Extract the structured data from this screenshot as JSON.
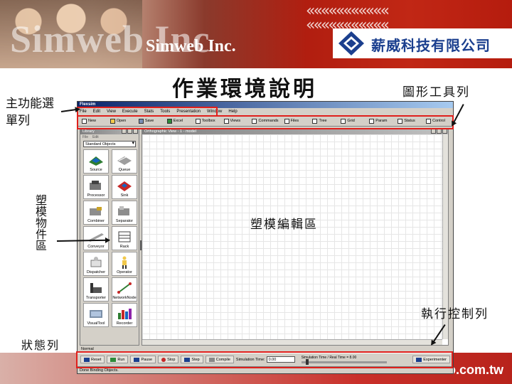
{
  "slide": {
    "brand_big": "Simweb Inc",
    "brand_small": "Simweb Inc.",
    "company_name": "薪威科技有限公司",
    "title": "作業環境說明",
    "footer_url": "o.com.tw"
  },
  "callouts": {
    "menu": "主功能選單列",
    "toolbar": "圖形工具列",
    "objects": "塑模物件區",
    "editor": "塑模編輯區",
    "run": "執行控制列",
    "status": "狀態列"
  },
  "app": {
    "title": "Flexsim",
    "menu": [
      "File",
      "Edit",
      "View",
      "Execute",
      "Stats",
      "Tools",
      "Presentation",
      "Window",
      "Help"
    ],
    "toolbar": [
      "New",
      "Open",
      "Save",
      "Excel",
      "Toolbox",
      "Views",
      "Commands",
      "Files",
      "Tree",
      "Grid",
      "Param",
      "Status",
      "Control"
    ],
    "library": {
      "title": "Library",
      "menu": [
        "File",
        "Edit"
      ],
      "dropdown": "Standard Objects",
      "items": [
        "Source",
        "Queue",
        "Processor",
        "Sink",
        "Combiner",
        "Separator",
        "Conveyor",
        "Rack",
        "Dispatcher",
        "Operator",
        "Transporter",
        "NetworkNode",
        "VisualTool",
        "Recorder"
      ]
    },
    "ortho_title": "Orthographic View - 1 - model",
    "mode_text": "Normal",
    "run": {
      "reset": "Reset",
      "run": "Run",
      "pause": "Pause",
      "stop": "Stop",
      "step": "Step",
      "compile": "Compile",
      "sim_time_label": "Simulation Time:",
      "sim_time_value": "0.00",
      "run_speed": "Simulation Time / Real Time = 8.00",
      "experimenter": "Experimenter"
    },
    "status_text": "Done Binding Objects."
  },
  "colors": {
    "accent_red": "#e0201c",
    "brand_blue": "#1b3f8e"
  }
}
